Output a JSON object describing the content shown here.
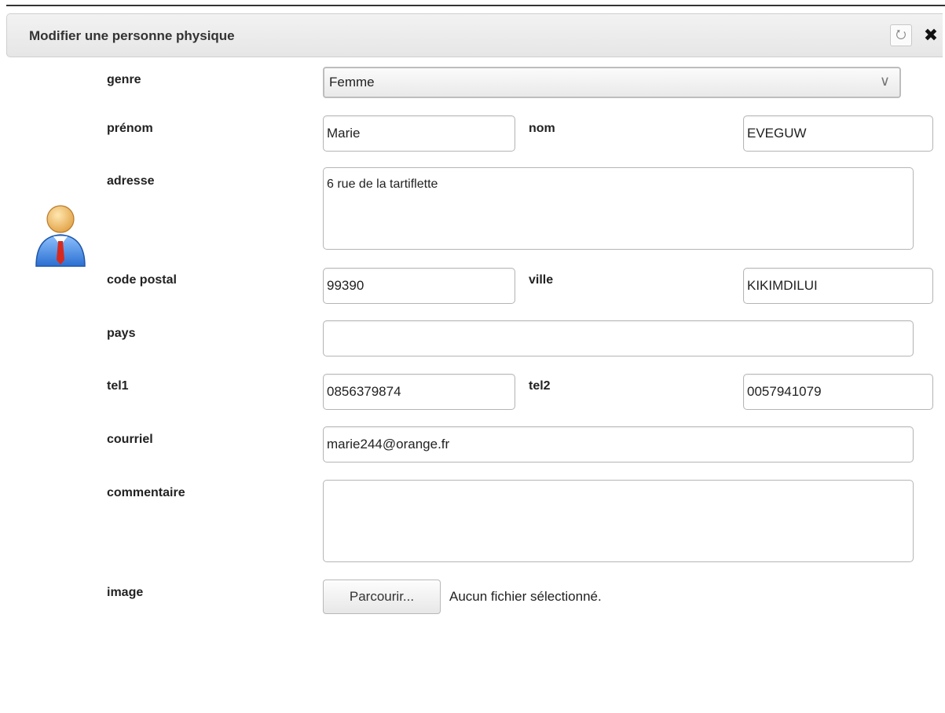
{
  "dialog": {
    "title": "Modifier une personne physique",
    "refresh_icon": "refresh-icon",
    "close_icon": "close-icon"
  },
  "avatar_icon": "person-avatar-icon",
  "form": {
    "genre": {
      "label": "genre",
      "value": "Femme"
    },
    "prenom": {
      "label": "prénom",
      "value": "Marie"
    },
    "nom": {
      "label": "nom",
      "value": "EVEGUW"
    },
    "adresse": {
      "label": "adresse",
      "value": "6 rue de la tartiflette"
    },
    "code_postal": {
      "label": "code postal",
      "value": "99390"
    },
    "ville": {
      "label": "ville",
      "value": "KIKIMDILUI"
    },
    "pays": {
      "label": "pays",
      "value": ""
    },
    "tel1": {
      "label": "tel1",
      "value": "0856379874"
    },
    "tel2": {
      "label": "tel2",
      "value": "0057941079"
    },
    "courriel": {
      "label": "courriel",
      "value": "marie244@orange.fr"
    },
    "commentaire": {
      "label": "commentaire",
      "value": ""
    },
    "image": {
      "label": "image",
      "browse_label": "Parcourir...",
      "status": "Aucun fichier sélectionné."
    }
  }
}
